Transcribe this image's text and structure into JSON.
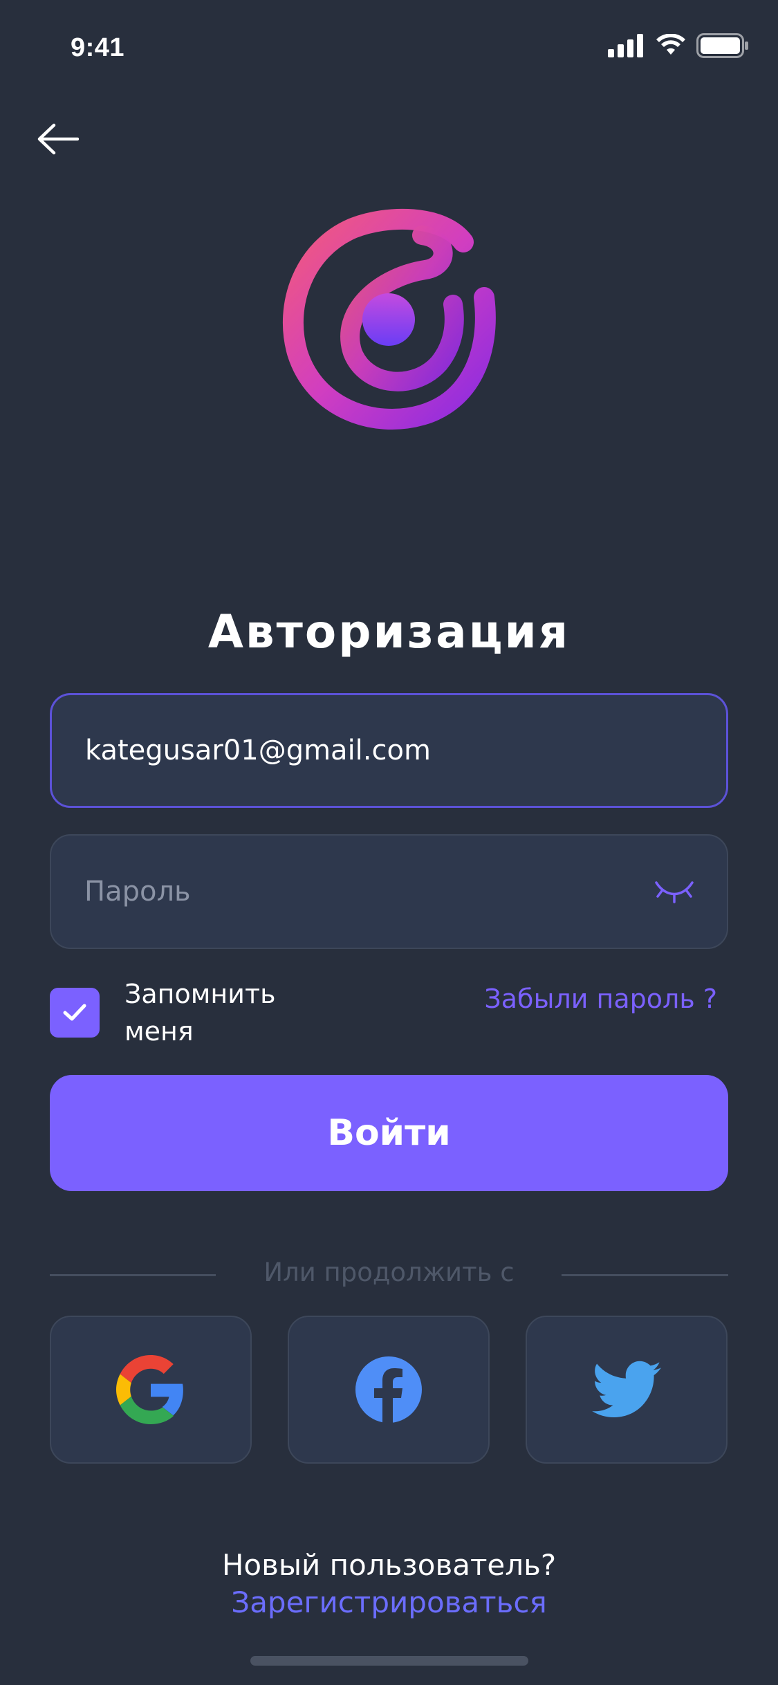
{
  "status_bar": {
    "time": "9:41"
  },
  "header": {
    "title": "Авторизация"
  },
  "form": {
    "email_value": "kategusar01@gmail.com",
    "password_placeholder": "Пароль",
    "remember_label": "Запомнить меня",
    "remember_checked": true,
    "forgot_label": "Забыли пароль ?",
    "login_label": "Войти"
  },
  "social": {
    "divider_text": "Или продолжить с",
    "buttons": [
      "google-icon",
      "facebook-icon",
      "twitter-icon"
    ]
  },
  "footer": {
    "new_user_text": "Новый пользователь?",
    "register_link": "Зарегистрироваться"
  },
  "colors": {
    "background": "#282f3d",
    "field": "#2e384d",
    "accent": "#7b61ff",
    "link": "#6b6dfc"
  }
}
